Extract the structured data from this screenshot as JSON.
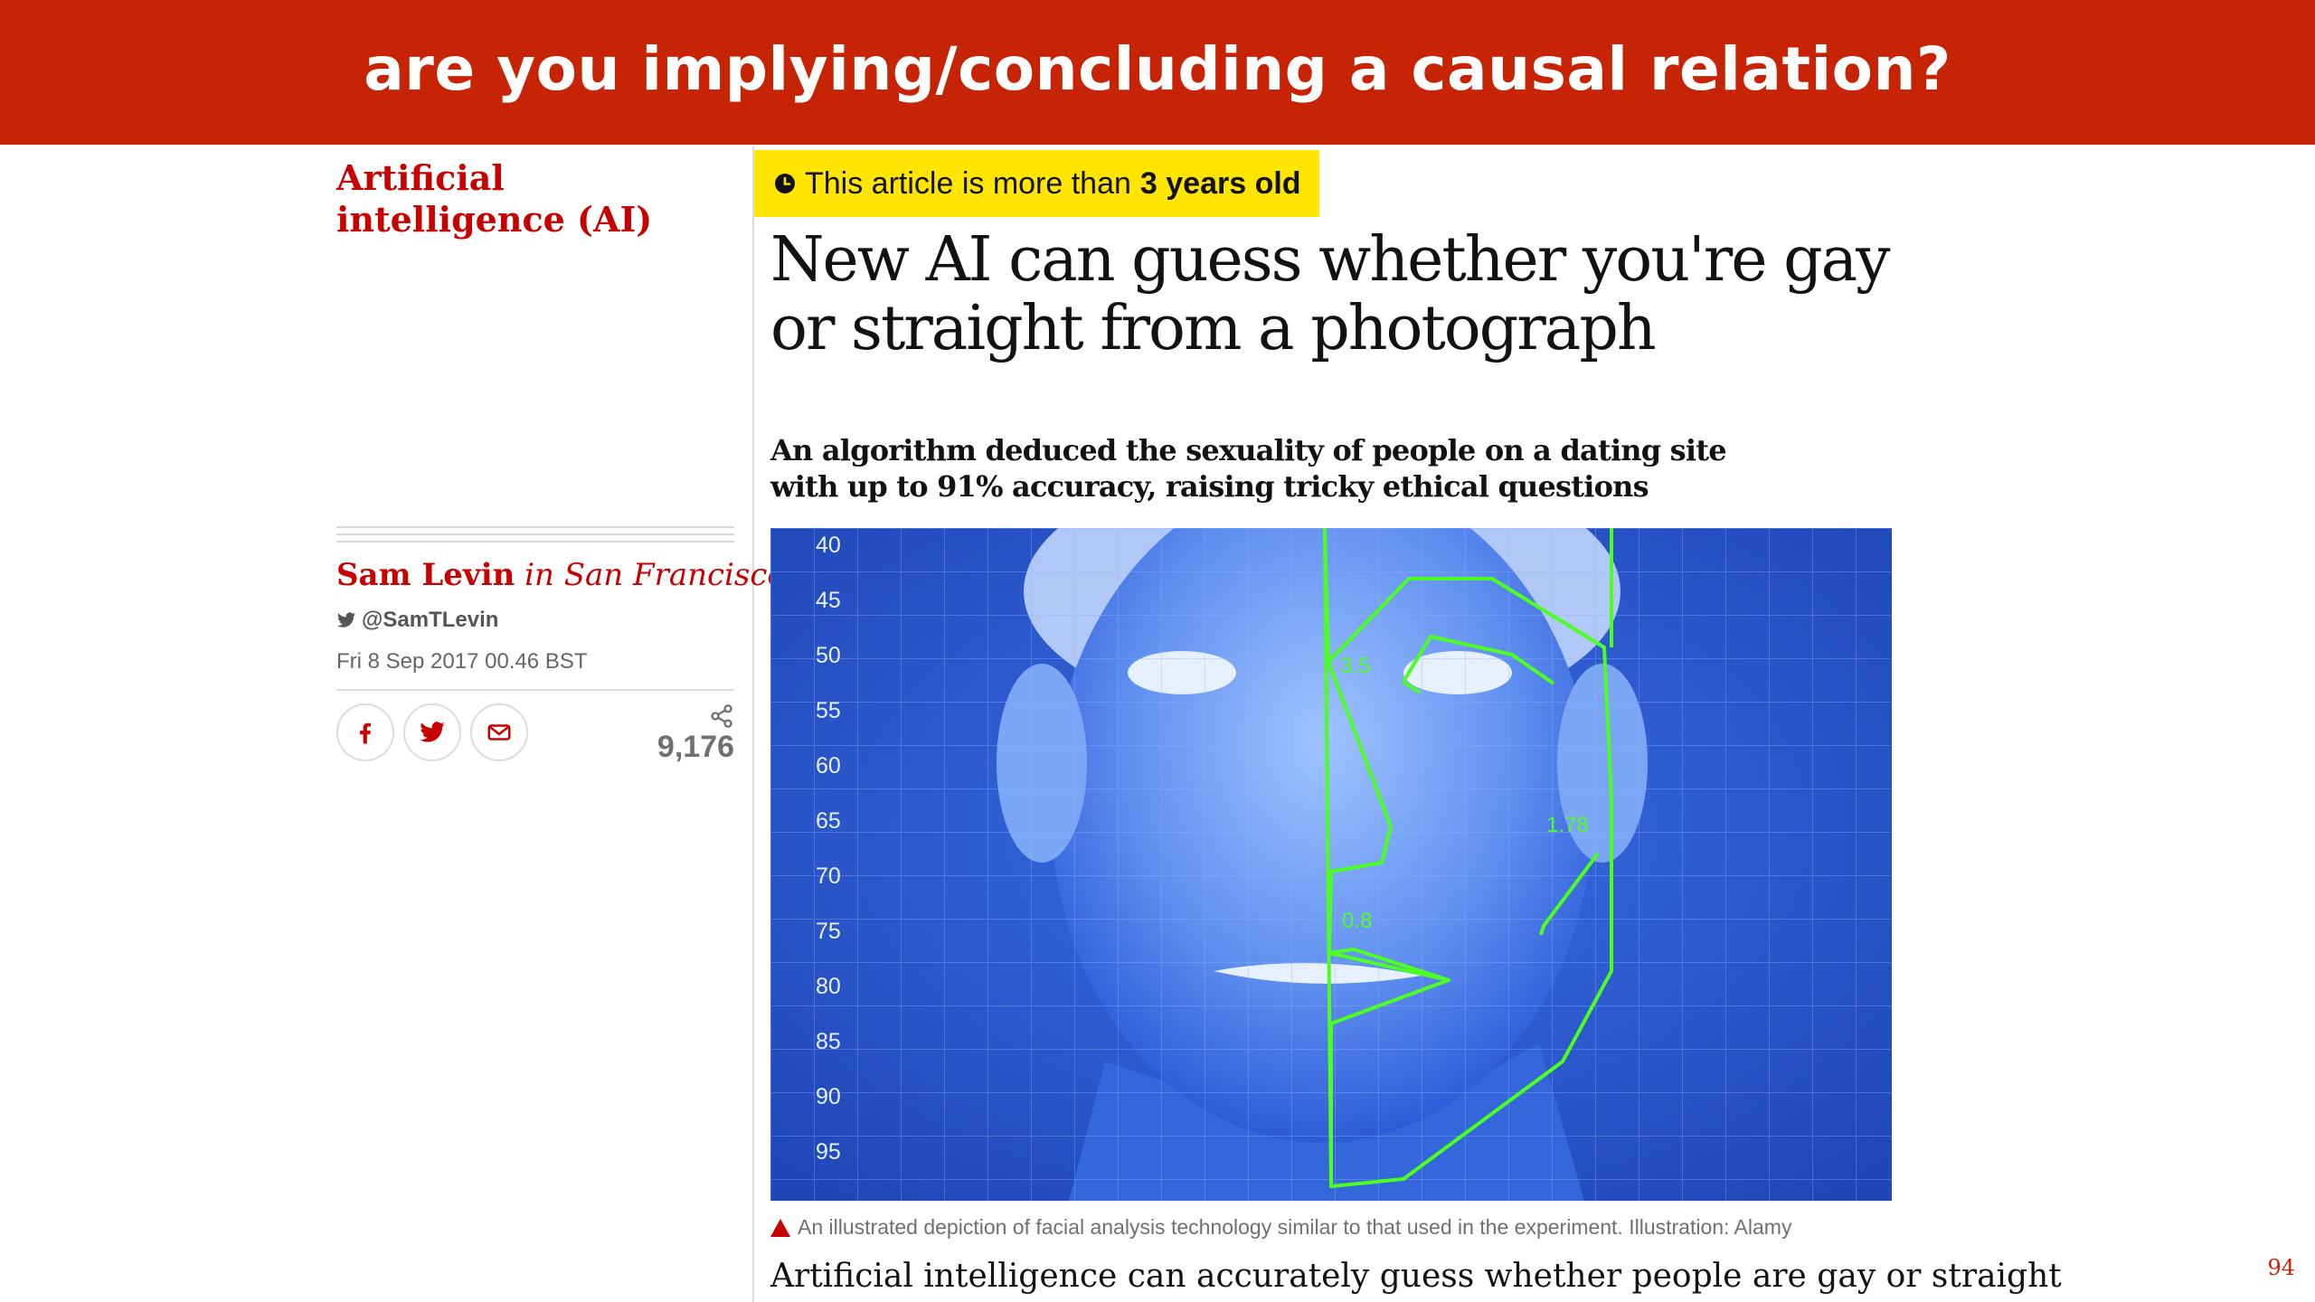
{
  "slide": {
    "title": "are you implying/concluding a causal relation?",
    "page_number": "94",
    "colors": {
      "banner": "#c72305",
      "guardian_red": "#c70000",
      "badge_yellow": "#ffe500",
      "overlay_green": "#4cff21",
      "photo_blue": "#2d5bd8"
    }
  },
  "article": {
    "section": "Artificial intelligence (AI)",
    "age_badge": {
      "prefix": "This article is more than",
      "emphasis": "3 years old",
      "icon": "clock-icon"
    },
    "headline": "New AI can guess whether you're gay or straight from a photograph",
    "standfirst": "An algorithm deduced the sexuality of people on a dating site with up to 91% accuracy, raising tricky ethical questions",
    "byline": {
      "author": "Sam Levin",
      "location": "in San Francisco",
      "twitter": "@SamTLevin",
      "date": "Fri 8 Sep 2017 00.46 BST"
    },
    "share": {
      "buttons": [
        "facebook-icon",
        "twitter-icon",
        "email-icon"
      ],
      "count": "9,176"
    },
    "image": {
      "ruler_labels": [
        "40",
        "45",
        "50",
        "55",
        "60",
        "65",
        "70",
        "75",
        "80",
        "85",
        "90",
        "95"
      ],
      "measurements": [
        "3.5",
        "1.78",
        "0.8"
      ]
    },
    "caption": "An illustrated depiction of facial analysis technology similar to that used in the experiment. Illustration: Alamy",
    "body_first_line": "Artificial intelligence can accurately guess whether people are gay or straight"
  }
}
